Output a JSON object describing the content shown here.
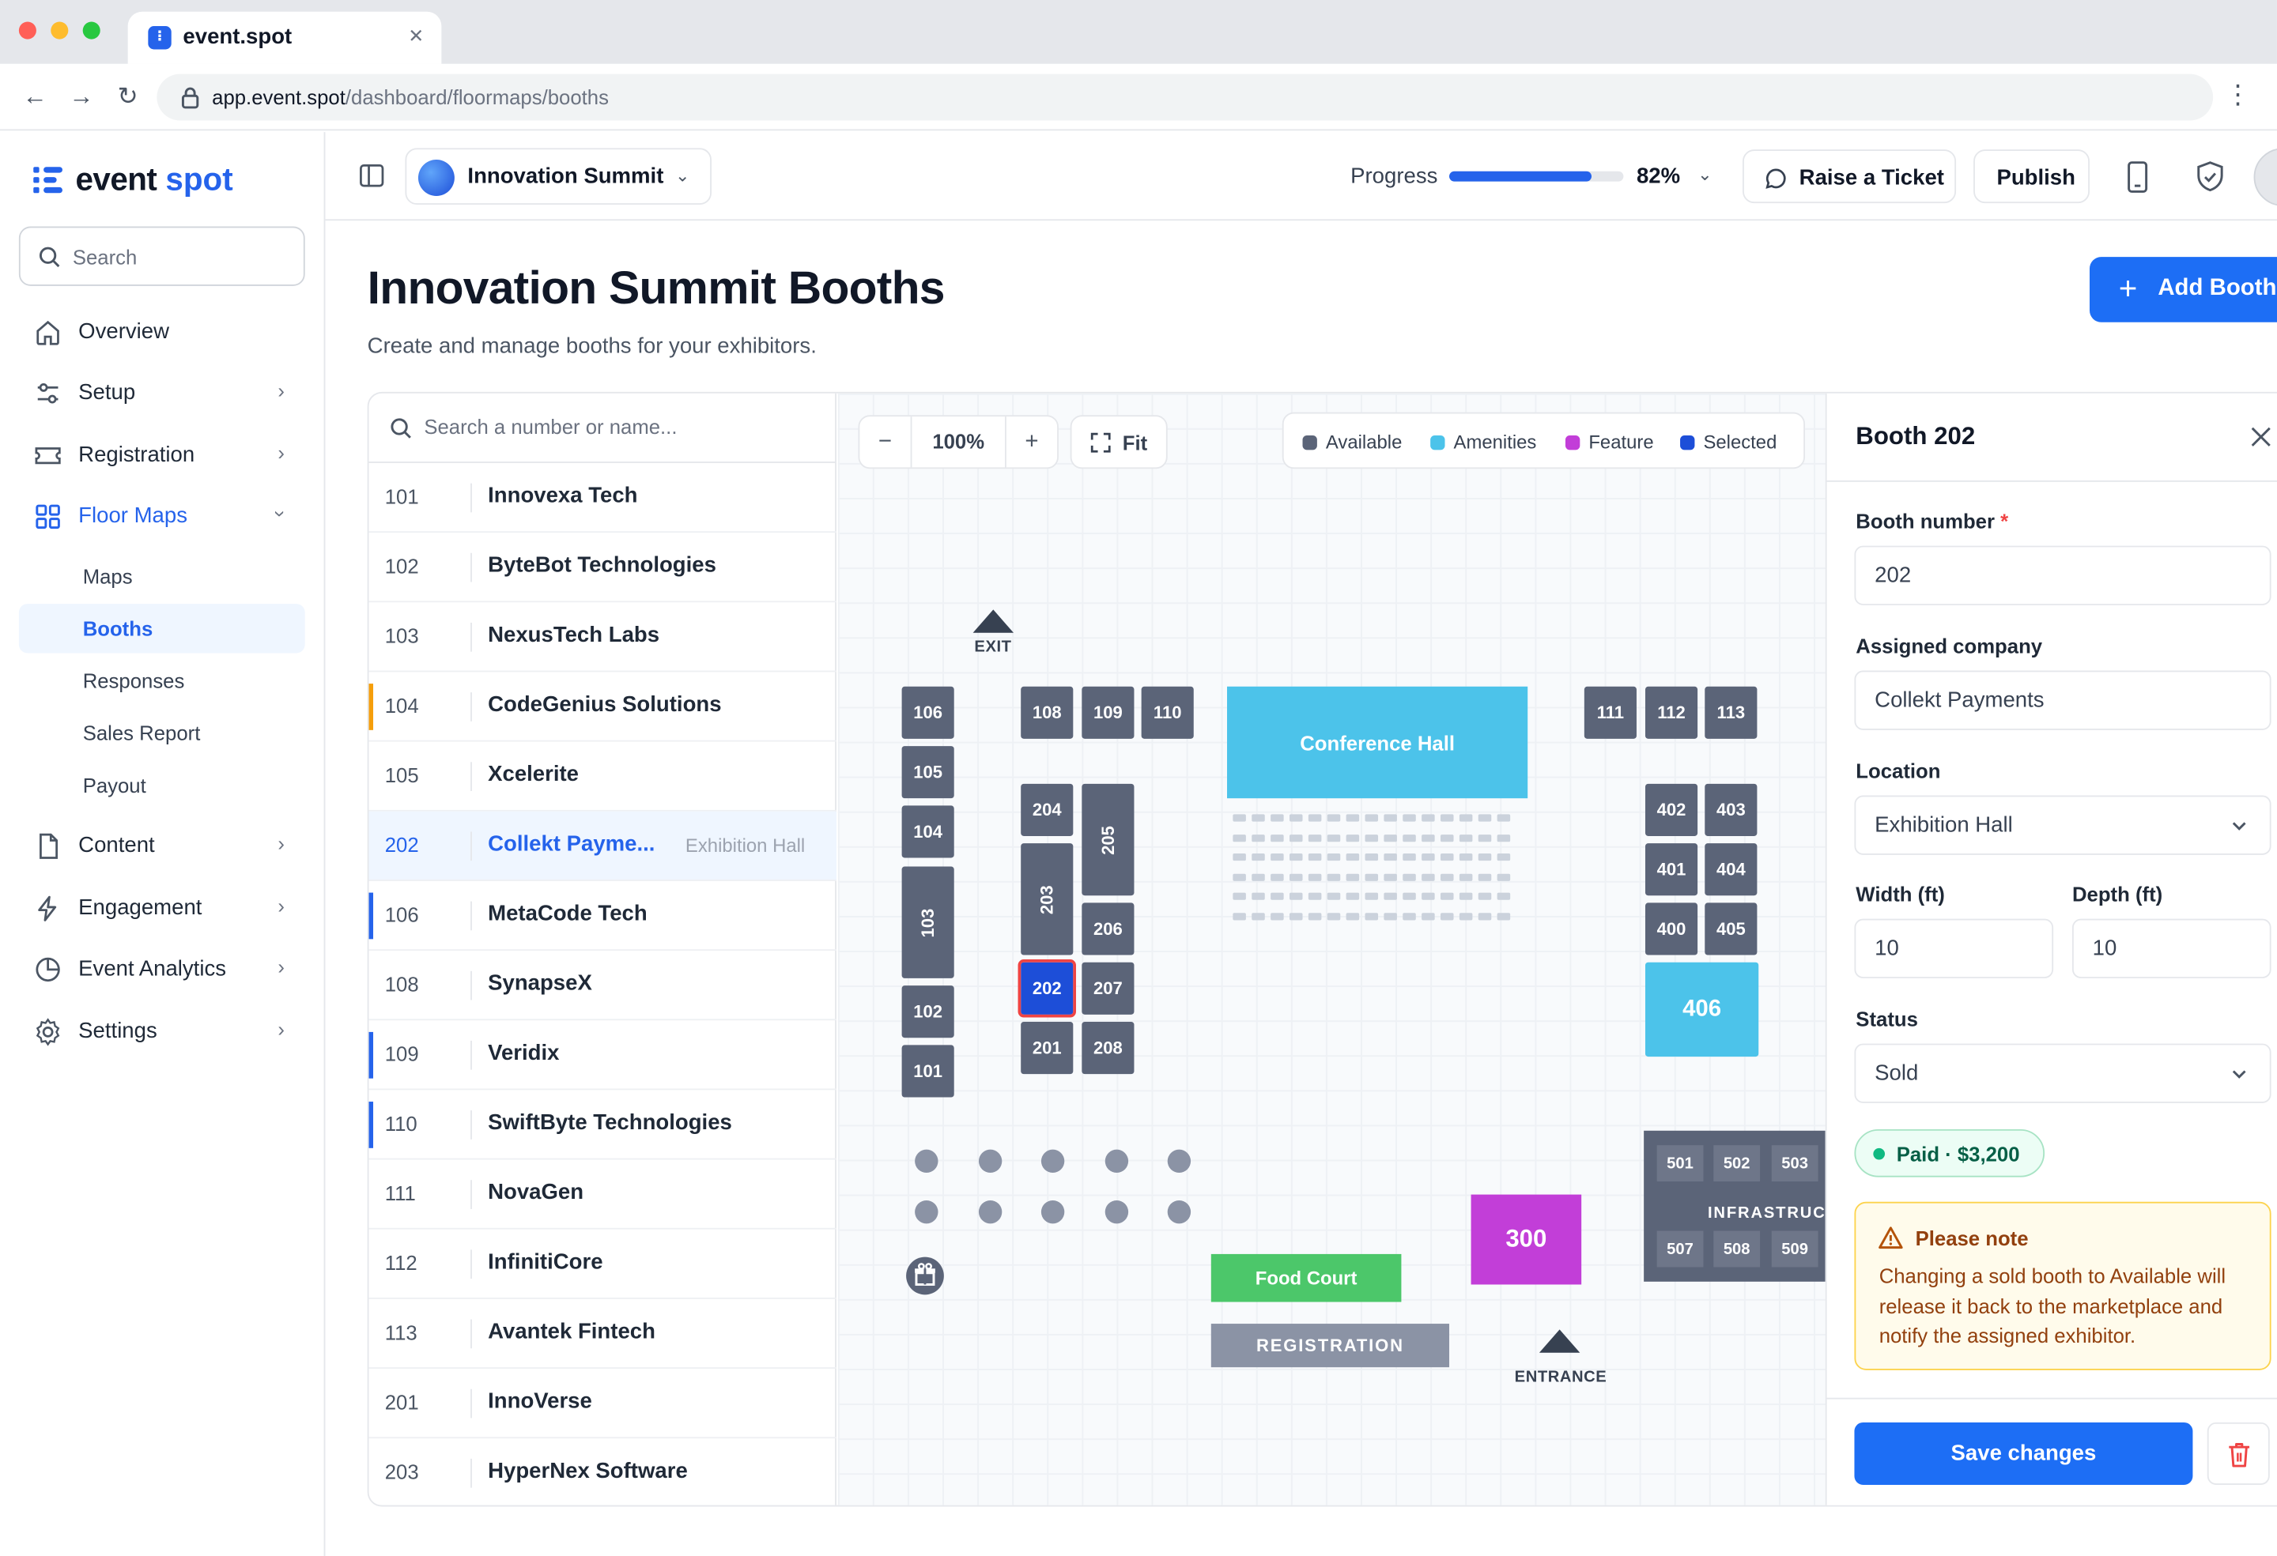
{
  "browser": {
    "tab_title": "event.spot",
    "url_host": "app.event.spot",
    "url_path": "/dashboard/floormaps/booths"
  },
  "sidebar": {
    "logo_part1": "event",
    "logo_part2": "spot",
    "search_placeholder": "Search",
    "items": [
      {
        "label": "Overview"
      },
      {
        "label": "Setup"
      },
      {
        "label": "Registration"
      },
      {
        "label": "Floor Maps"
      },
      {
        "label": "Content"
      },
      {
        "label": "Engagement"
      },
      {
        "label": "Event Analytics"
      },
      {
        "label": "Settings"
      }
    ],
    "sub_items": [
      {
        "label": "Maps"
      },
      {
        "label": "Booths"
      },
      {
        "label": "Responses"
      },
      {
        "label": "Sales Report"
      },
      {
        "label": "Payout"
      }
    ]
  },
  "header": {
    "event_name": "Innovation Summit",
    "progress_label": "Progress",
    "progress_value": "82%",
    "progress_fraction": 0.82,
    "raise_ticket": "Raise a Ticket",
    "publish": "Publish"
  },
  "page": {
    "title": "Innovation Summit Booths",
    "subtitle": "Create and manage booths for your exhibitors.",
    "add_button": "Add Booth"
  },
  "booth_list": {
    "search_placeholder": "Search a number or name...",
    "rows": [
      {
        "number": "101",
        "name": "Innovexa Tech",
        "location": "",
        "marker": ""
      },
      {
        "number": "102",
        "name": "ByteBot Technologies",
        "location": "",
        "marker": ""
      },
      {
        "number": "103",
        "name": "NexusTech Labs",
        "location": "",
        "marker": ""
      },
      {
        "number": "104",
        "name": "CodeGenius Solutions",
        "location": "",
        "marker": "#f59e0b"
      },
      {
        "number": "105",
        "name": "Xcelerite",
        "location": "",
        "marker": ""
      },
      {
        "number": "202",
        "name": "Collekt Payme...",
        "location": "Exhibition Hall",
        "marker": "",
        "selected": true
      },
      {
        "number": "106",
        "name": "MetaCode Tech",
        "location": "",
        "marker": "#2563eb"
      },
      {
        "number": "108",
        "name": "SynapseX",
        "location": "",
        "marker": ""
      },
      {
        "number": "109",
        "name": "Veridix",
        "location": "",
        "marker": "#2563eb"
      },
      {
        "number": "110",
        "name": "SwiftByte Technologies",
        "location": "",
        "marker": "#2563eb"
      },
      {
        "number": "111",
        "name": "NovaGen",
        "location": "",
        "marker": ""
      },
      {
        "number": "112",
        "name": "InfinitiCore",
        "location": "",
        "marker": ""
      },
      {
        "number": "113",
        "name": "Avantek Fintech",
        "location": "",
        "marker": ""
      },
      {
        "number": "201",
        "name": "InnoVerse",
        "location": "",
        "marker": ""
      },
      {
        "number": "203",
        "name": "HyperNex Software",
        "location": "",
        "marker": ""
      }
    ]
  },
  "map": {
    "zoom": "100%",
    "zoom_minus": "−",
    "zoom_plus": "+",
    "fit_label": "Fit",
    "legend": [
      {
        "label": "Available",
        "color": "#5b6478"
      },
      {
        "label": "Amenities",
        "color": "#4cc3ea"
      },
      {
        "label": "Feature",
        "color": "#c23ed8"
      },
      {
        "label": "Selected",
        "color": "#1d4ed8"
      }
    ],
    "booths": {
      "b106": "106",
      "b105": "105",
      "b104": "104",
      "b103": "103",
      "b102": "102",
      "b101": "101",
      "b108": "108",
      "b109": "109",
      "b110": "110",
      "b204": "204",
      "b205": "205",
      "b203": "203",
      "b206": "206",
      "b202": "202",
      "b207": "207",
      "b201": "201",
      "b208": "208",
      "b111": "111",
      "b112": "112",
      "b113": "113",
      "b402": "402",
      "b403": "403",
      "b401": "401",
      "b404": "404",
      "b400": "400",
      "b405": "405",
      "b406": "406",
      "b300": "300"
    },
    "conference_hall": "Conference Hall",
    "food_court": "Food Court",
    "registration": "REGISTRATION",
    "infrastructure": "INFRASTRUCTURE",
    "infra_booths": [
      "501",
      "502",
      "503",
      "507",
      "508",
      "509"
    ],
    "exit": "EXIT",
    "entrance": "ENTRANCE"
  },
  "panel": {
    "title": "Booth 202",
    "booth_number_label": "Booth number",
    "required_mark": "*",
    "booth_number": "202",
    "company_label": "Assigned company",
    "company": "Collekt Payments",
    "location_label": "Location",
    "location": "Exhibition Hall",
    "width_label": "Width (ft)",
    "width": "10",
    "depth_label": "Depth (ft)",
    "depth": "10",
    "status_label": "Status",
    "status": "Sold",
    "paid_badge": "Paid · $3,200",
    "note_title": "Please note",
    "note_body": "Changing a sold booth to Available will release it back to the marketplace and notify the assigned exhibitor.",
    "save": "Save changes"
  }
}
